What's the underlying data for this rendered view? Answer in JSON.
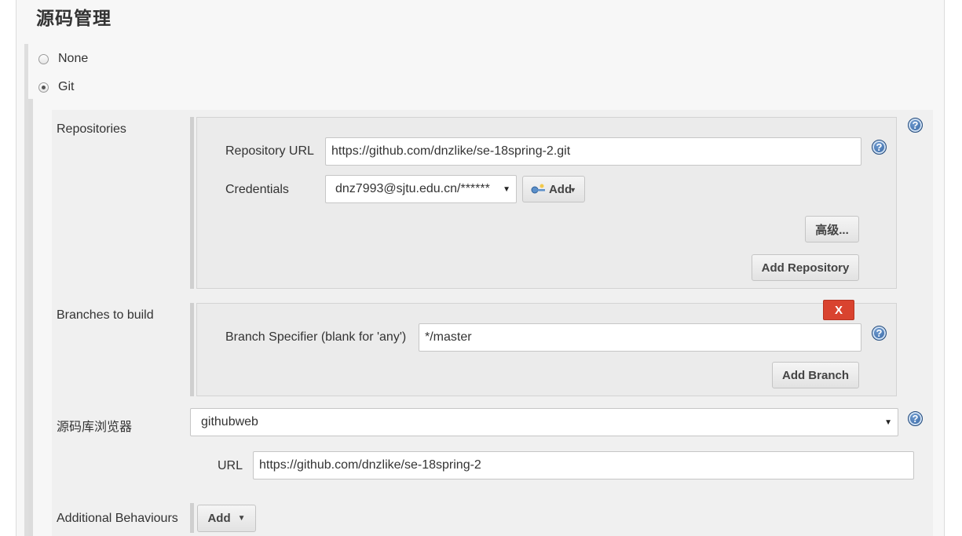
{
  "section": {
    "title": "源码管理"
  },
  "scm": {
    "options": [
      {
        "label": "None",
        "checked": false
      },
      {
        "label": "Git",
        "checked": true
      }
    ]
  },
  "repositories": {
    "label": "Repositories",
    "url_label": "Repository URL",
    "url_value": "https://github.com/dnzlike/se-18spring-2.git",
    "credentials_label": "Credentials",
    "credentials_value": "dnz7993@sjtu.edu.cn/******",
    "add_credentials_label": "Add",
    "advanced_label": "高级...",
    "add_repository_label": "Add Repository"
  },
  "branches": {
    "label": "Branches to build",
    "delete_label": "X",
    "specifier_label": "Branch Specifier (blank for 'any')",
    "specifier_value": "*/master",
    "add_branch_label": "Add Branch"
  },
  "browser": {
    "label": "源码库浏览器",
    "selected": "githubweb",
    "url_label": "URL",
    "url_value": "https://github.com/dnzlike/se-18spring-2"
  },
  "behaviours": {
    "label": "Additional Behaviours",
    "add_label": "Add"
  },
  "help_icon_glyph": "?",
  "colors": {
    "delete_button": "#d9432f",
    "help_icon": "#2f5f9c"
  }
}
